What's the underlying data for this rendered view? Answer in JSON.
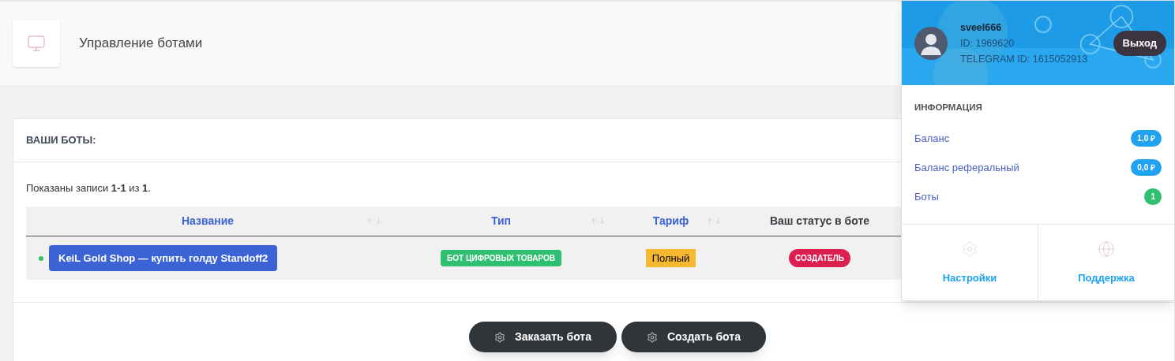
{
  "page_header": {
    "title": "Управление ботами"
  },
  "card": {
    "title": "ВАШИ БОТЫ:",
    "summary": "Показаны записи **1-1** из **1**.",
    "table": {
      "columns": [
        {
          "label": "Название",
          "sortable": true
        },
        {
          "label": "Тип",
          "sortable": true
        },
        {
          "label": "Тариф",
          "sortable": true
        },
        {
          "label": "Ваш статус в боте",
          "sortable": false
        }
      ],
      "rows": [
        {
          "online": true,
          "name": "KeiL Gold Shop — купить голду Standoff2",
          "type": "БОТ ЦИФРОВЫХ ТОВАРОВ",
          "tariff": "Полный",
          "status": "СОЗДАТЕЛЬ"
        }
      ]
    },
    "buttons": [
      "Заказать бота",
      "Создать бота"
    ]
  },
  "user_menu": {
    "username": "sveel666",
    "id": "ID: 1969620",
    "telegram_id": "TELEGRAM ID: 1615052913",
    "logout": "Выход",
    "section_title": "ИНФОРМАЦИЯ",
    "items": [
      {
        "label": "Баланс",
        "badge": "1,0 ₽",
        "color": "#1fa2f0"
      },
      {
        "label": "Баланс реферальный",
        "badge": "0,0 ₽",
        "color": "#1fa2f0"
      },
      {
        "label": "Боты",
        "badge": "1",
        "color": "#2fbf71"
      }
    ],
    "links": [
      {
        "kind": "settings",
        "label": "Настройки"
      },
      {
        "kind": "support",
        "label": "Поддержка"
      }
    ]
  }
}
